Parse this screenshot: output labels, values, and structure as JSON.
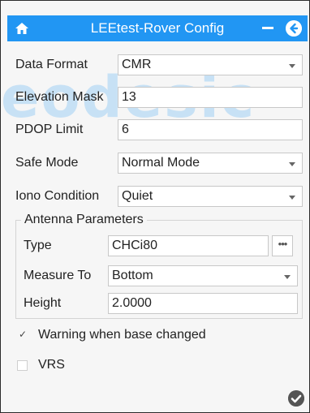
{
  "window": {
    "title": "LEEtest-Rover Config"
  },
  "watermark": "eodesic",
  "fields": {
    "data_format": {
      "label": "Data Format",
      "value": "CMR"
    },
    "elevation_mask": {
      "label": "Elevation Mask",
      "value": "13"
    },
    "pdop_limit": {
      "label": "PDOP Limit",
      "value": "6"
    },
    "safe_mode": {
      "label": "Safe Mode",
      "value": "Normal Mode"
    },
    "iono_condition": {
      "label": "Iono Condition",
      "value": "Quiet"
    }
  },
  "antenna": {
    "legend": "Antenna Parameters",
    "type": {
      "label": "Type",
      "value": "CHCi80",
      "more": "•••"
    },
    "measure_to": {
      "label": "Measure To",
      "value": "Bottom"
    },
    "height": {
      "label": "Height",
      "value": "2.0000"
    }
  },
  "options": {
    "warning": {
      "label": "Warning when base changed",
      "checked": true,
      "mark": "✓"
    },
    "vrs": {
      "label": "VRS",
      "checked": false
    }
  },
  "colors": {
    "header": "#2196f3",
    "watermark": "#2196f3"
  }
}
